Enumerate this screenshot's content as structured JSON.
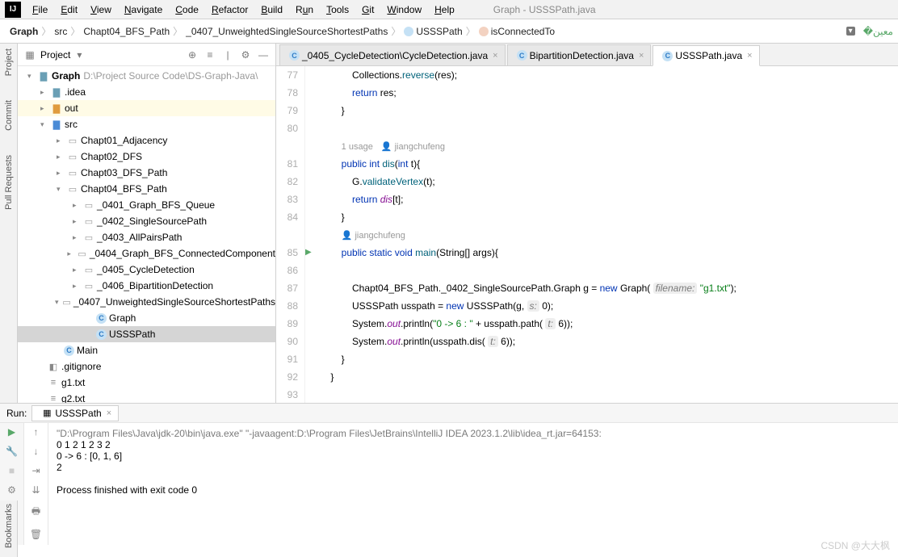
{
  "title": "Graph - USSSPath.java",
  "menu": [
    "File",
    "Edit",
    "View",
    "Navigate",
    "Code",
    "Refactor",
    "Build",
    "Run",
    "Tools",
    "Git",
    "Window",
    "Help"
  ],
  "breadcrumbs": {
    "items": [
      "Graph",
      "src",
      "Chapt04_BFS_Path",
      "_0407_UnweightedSingleSourceShortestPaths",
      "USSSPath",
      "isConnectedTo"
    ]
  },
  "left_tools": [
    "Project",
    "Commit",
    "Pull Requests"
  ],
  "bottom_tool": "Bookmarks",
  "project_panel": {
    "title": "Project",
    "root": "Graph",
    "root_path": "D:\\Project Source Code\\DS-Graph-Java\\",
    "idea": ".idea",
    "out": "out",
    "src": "src",
    "pkgs": [
      "Chapt01_Adjacency",
      "Chapt02_DFS",
      "Chapt03_DFS_Path",
      "Chapt04_BFS_Path"
    ],
    "sub": [
      "_0401_Graph_BFS_Queue",
      "_0402_SingleSourcePath",
      "_0403_AllPairsPath",
      "_0404_Graph_BFS_ConnectedComponent",
      "_0405_CycleDetection",
      "_0406_BipartitionDetection",
      "_0407_UnweightedSingleSourceShortestPaths"
    ],
    "classes": [
      "Graph",
      "USSSPath"
    ],
    "main": "Main",
    "git": ".gitignore",
    "g1": "g1.txt",
    "g2": "g2.txt"
  },
  "tabs": [
    {
      "label": "_0405_CycleDetection\\CycleDetection.java"
    },
    {
      "label": "BipartitionDetection.java"
    },
    {
      "label": "USSSPath.java"
    }
  ],
  "code": {
    "l77": "            Collections.reverse(res);",
    "l78": "            return res;",
    "l79": "        }",
    "l80": "",
    "hint1a": "1 usage",
    "hint1b": "jiangchufeng",
    "l81a": "public",
    "l81b": "int",
    "l81c": "dis",
    "l81d": "int",
    "l81e": "t",
    "l82a": "G",
    "l82b": "validateVertex",
    "l82c": "t",
    "l83a": "return",
    "l83b": "dis",
    "l83c": "t",
    "l84": "        }",
    "hint2": "jiangchufeng",
    "l85a": "public",
    "l85b": "static",
    "l85c": "void",
    "l85d": "main",
    "l85e": "String",
    "l85f": "args",
    "l86": "",
    "l87a": "Chapt04_BFS_Path._0402_SingleSourcePath.Graph g = ",
    "l87b": "new",
    "l87c": "Graph",
    "l87p": "filename:",
    "l87s": "\"g1.txt\"",
    "l88a": "USSSPath usspath = ",
    "l88b": "new",
    "l88c": "USSSPath",
    "l88d": "g",
    "l88p": "s:",
    "l88v": "0",
    "l89a": "System.",
    "l89b": "out",
    "l89c": ".println(",
    "l89s": "\"0 -> 6 : \"",
    "l89d": " + usspath.path(",
    "l89p": "t:",
    "l89v": "6",
    "l90a": "System.",
    "l90b": "out",
    "l90c": ".println(usspath.dis(",
    "l90p": "t:",
    "l90v": "6",
    "l91": "        }",
    "l92": "    }"
  },
  "run": {
    "label": "Run:",
    "tab": "USSSPath",
    "cmd": "\"D:\\Program Files\\Java\\jdk-20\\bin\\java.exe\" \"-javaagent:D:\\Program Files\\JetBrains\\IntelliJ IDEA 2023.1.2\\lib\\idea_rt.jar=64153:",
    "out1": "0 1 2 1 2 3 2",
    "out2": "0 -> 6 : [0, 1, 6]",
    "out3": "2",
    "exit": "Process finished with exit code 0"
  },
  "watermark": "CSDN @大大枫"
}
